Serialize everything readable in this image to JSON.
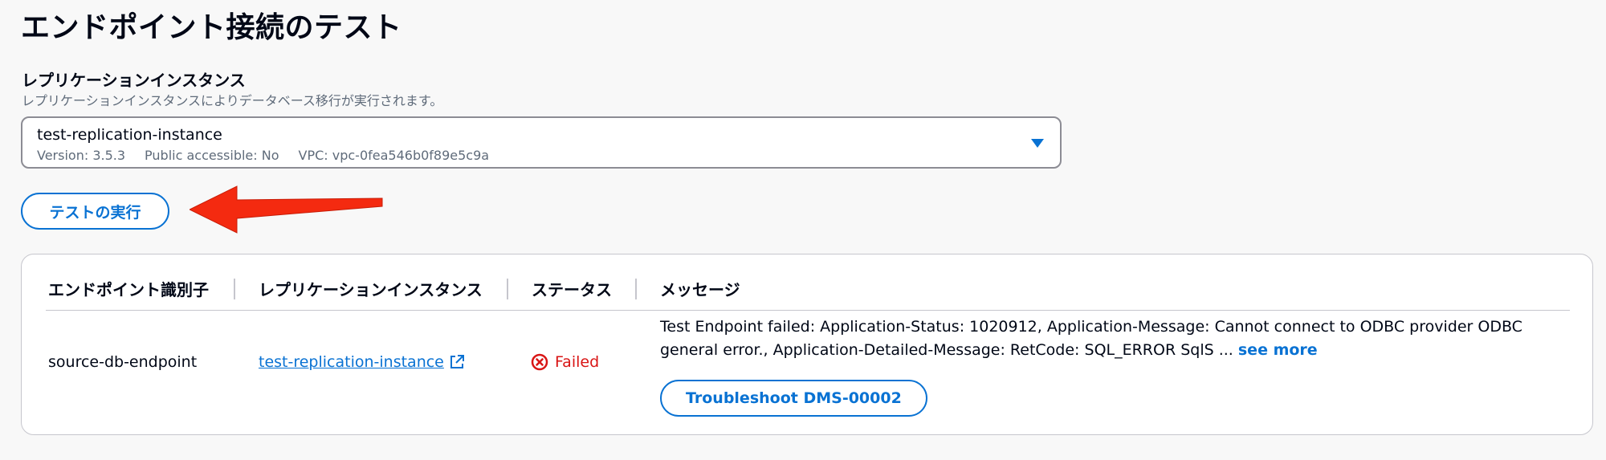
{
  "page": {
    "title": "エンドポイント接続のテスト"
  },
  "replication_field": {
    "label": "レプリケーションインスタンス",
    "description": "レプリケーションインスタンスによりデータベース移行が実行されます。",
    "selected": {
      "name": "test-replication-instance",
      "version": "Version: 3.5.3",
      "public_accessible": "Public accessible: No",
      "vpc": "VPC: vpc-0fea546b0f89e5c9a"
    },
    "caret_icon": "caret-down-icon"
  },
  "actions": {
    "run_test_label": "テストの実行"
  },
  "annotation": {
    "arrow_color": "#f42a10",
    "icon": "red-arrow-left-icon"
  },
  "results_table": {
    "columns": [
      "エンドポイント識別子",
      "レプリケーションインスタンス",
      "ステータス",
      "メッセージ"
    ],
    "rows": [
      {
        "endpoint_id": "source-db-endpoint",
        "replication_instance": "test-replication-instance",
        "status": "Failed",
        "message_line1": "Test Endpoint failed: Application-Status: 1020912, Application-Message: Cannot connect to ODBC provider ODBC",
        "message_line2": "general error., Application-Detailed-Message: RetCode: SQL_ERROR SqlS ...",
        "see_more": "see more",
        "troubleshoot_label": "Troubleshoot DMS-00002"
      }
    ]
  },
  "colors": {
    "link_blue": "#0972d3",
    "error_red": "#d91515",
    "text": "#000716",
    "muted": "#5f6b7a",
    "border": "#c6c6cd"
  }
}
